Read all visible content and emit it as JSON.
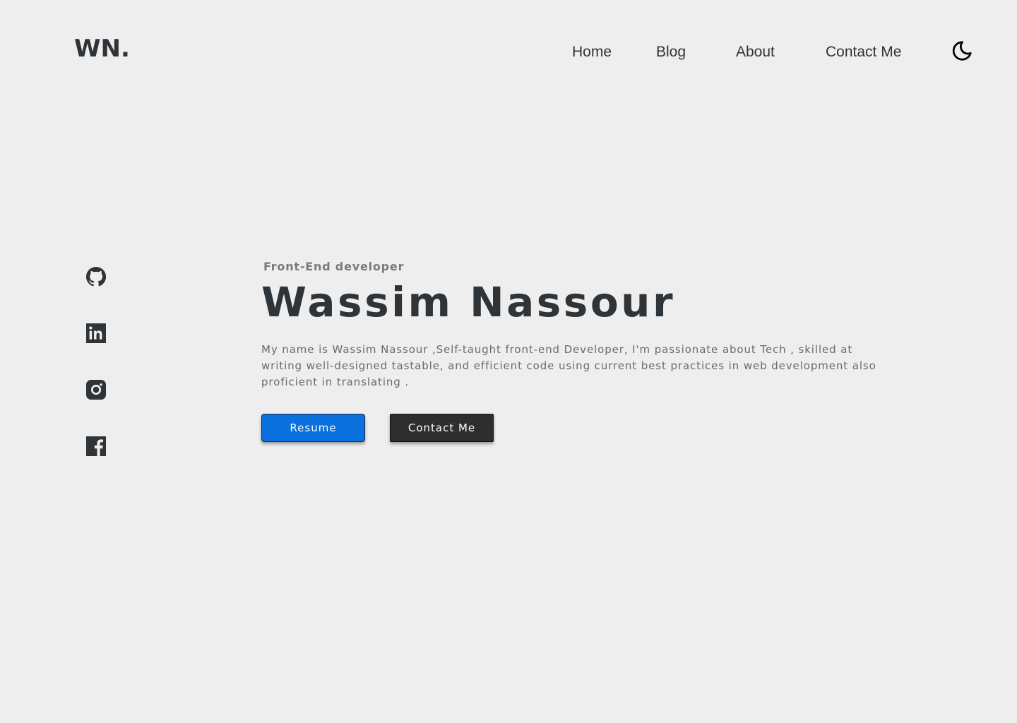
{
  "header": {
    "logo": "WN.",
    "nav": {
      "home": "Home",
      "blog": "Blog",
      "about": "About",
      "contact": "Contact Me"
    },
    "theme_toggle_icon": "moon-icon"
  },
  "socials": [
    {
      "name": "github",
      "icon": "github-icon"
    },
    {
      "name": "linkedin",
      "icon": "linkedin-icon"
    },
    {
      "name": "instagram",
      "icon": "instagram-icon"
    },
    {
      "name": "facebook",
      "icon": "facebook-icon"
    }
  ],
  "hero": {
    "role": "Front-End developer",
    "name": "Wassim Nassour",
    "bio": "My name is Wassim Nassour ,Self-taught front-end Developer, I'm passionate about Tech , skilled at writing well-designed tastable, and efficient code using current best practices in web development also proficient in translating ."
  },
  "buttons": {
    "resume": "Resume",
    "contact": "Contact Me"
  },
  "colors": {
    "background": "#eeeeee",
    "text_dark": "#2f3439",
    "accent_blue": "#0a71de",
    "button_dark": "#302d2d"
  }
}
